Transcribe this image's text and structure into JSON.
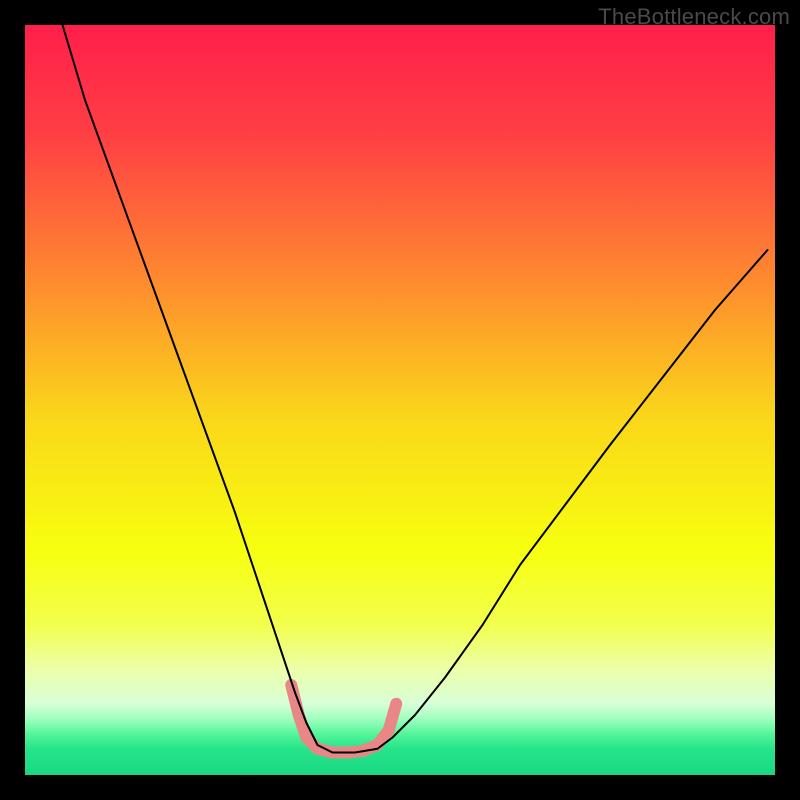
{
  "watermark": "TheBottleneck.com",
  "chart_data": {
    "type": "line",
    "title": "",
    "xlabel": "",
    "ylabel": "",
    "xlim": [
      0,
      100
    ],
    "ylim": [
      0,
      100
    ],
    "background_gradient": {
      "stops": [
        {
          "pos": 0.0,
          "color": "#ff1f4b"
        },
        {
          "pos": 0.15,
          "color": "#ff4044"
        },
        {
          "pos": 0.35,
          "color": "#fe8e2e"
        },
        {
          "pos": 0.52,
          "color": "#fad61a"
        },
        {
          "pos": 0.7,
          "color": "#f7ff0f"
        },
        {
          "pos": 0.8,
          "color": "#f2ff4d"
        },
        {
          "pos": 0.86,
          "color": "#ecffab"
        },
        {
          "pos": 0.905,
          "color": "#d8ffd8"
        },
        {
          "pos": 0.925,
          "color": "#9fffbf"
        },
        {
          "pos": 0.945,
          "color": "#55f59a"
        },
        {
          "pos": 0.965,
          "color": "#26e48b"
        },
        {
          "pos": 1.0,
          "color": "#18d882"
        }
      ]
    },
    "series": [
      {
        "name": "bottleneck-curve",
        "stroke": "#000000",
        "stroke_width": 2,
        "x": [
          5,
          8,
          12,
          16,
          20,
          24,
          28,
          31,
          34,
          36,
          37.5,
          39,
          41,
          44,
          47,
          49,
          52,
          56,
          61,
          66,
          72,
          78,
          85,
          92,
          99
        ],
        "y": [
          100,
          90,
          79,
          68,
          57,
          46,
          35,
          26,
          17,
          11,
          7,
          4,
          3,
          3,
          3.5,
          5,
          8,
          13,
          20,
          28,
          36,
          44,
          53,
          62,
          70
        ]
      }
    ],
    "highlight": {
      "name": "optimal-range",
      "stroke": "#e98787",
      "stroke_width": 12,
      "points_x": [
        35.5,
        36.5,
        37.5,
        39.0,
        41.0,
        43.0,
        45.0,
        47.0,
        48.5,
        49.5
      ],
      "points_y": [
        12.0,
        8.0,
        5.0,
        3.5,
        3.0,
        3.0,
        3.2,
        4.0,
        6.0,
        9.5
      ]
    }
  }
}
